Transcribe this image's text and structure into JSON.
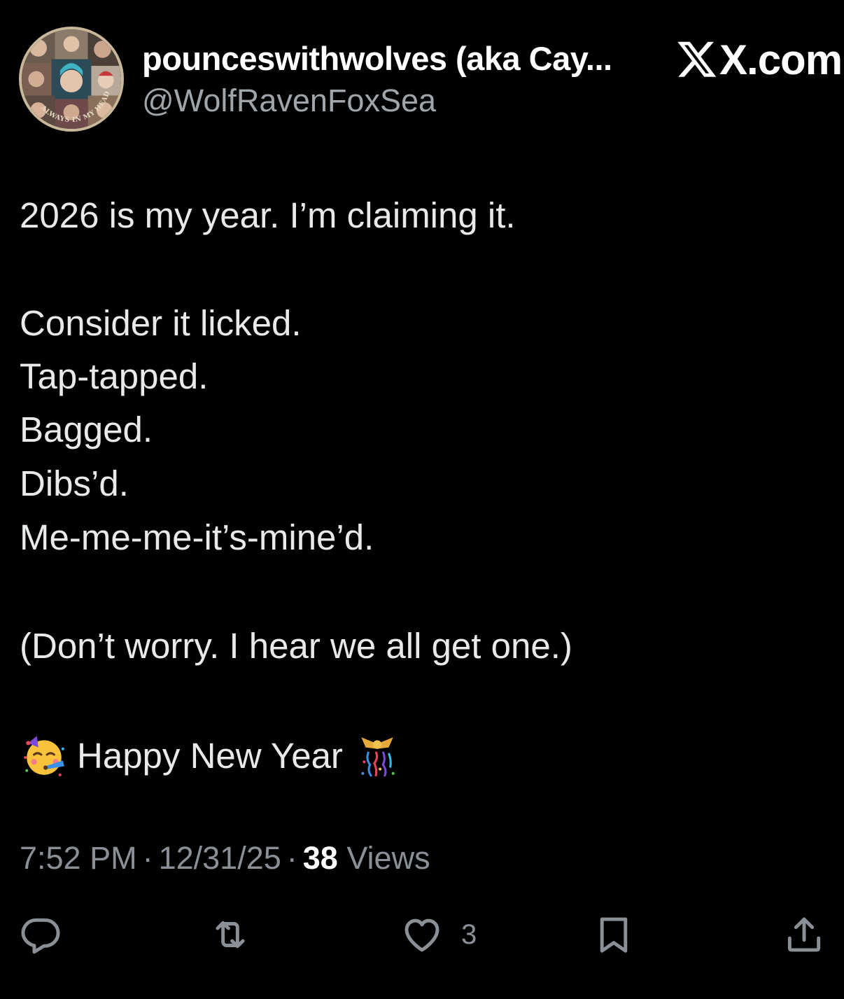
{
  "header": {
    "display_name": "pounceswithwolves (aka Cay...",
    "handle": "@WolfRavenFoxSea",
    "brand_text": "X.com",
    "avatar_ring_text": "ALWAYS IN MY HEAD"
  },
  "tweet": {
    "lines": [
      "2026 is my year. I’m claiming it.",
      "Consider it licked.",
      "Tap-tapped.",
      "Bagged.",
      "Dibs’d.",
      "Me-me-me-it’s-mine’d.",
      "(Don’t worry. I hear we all get one.)",
      "Happy New Year"
    ],
    "emojis": {
      "left": "partying-face-emoji",
      "right": "confetti-ball-emoji"
    }
  },
  "meta": {
    "time": "7:52 PM",
    "date": "12/31/25",
    "separator": "·",
    "views_count": "38",
    "views_label": "Views"
  },
  "actions": {
    "reply_icon": "reply-icon",
    "retweet_icon": "retweet-icon",
    "like_icon": "heart-icon",
    "like_count": "3",
    "bookmark_icon": "bookmark-icon",
    "share_icon": "share-icon"
  },
  "colors": {
    "background": "#000000",
    "primary_text": "#e7e9ea",
    "secondary_text": "#8b9096",
    "name_text": "#ffffff",
    "avatar_border": "#c9b79a"
  }
}
